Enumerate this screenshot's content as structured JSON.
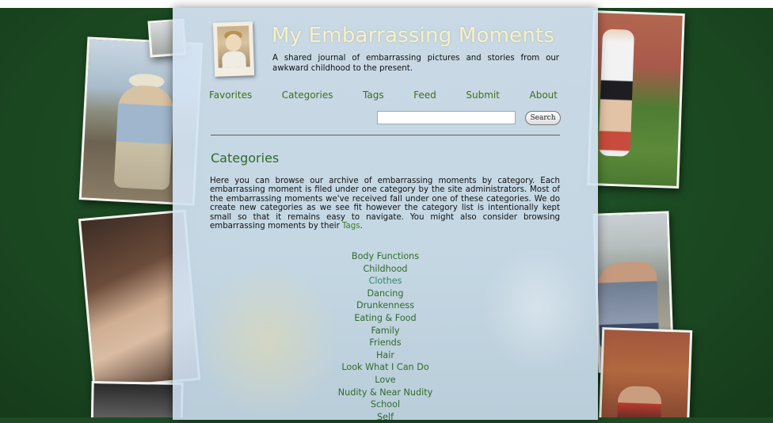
{
  "site": {
    "title": "My Embarrassing Moments",
    "tagline": "A shared journal of embarrassing pictures and stories from our awkward childhood to the present."
  },
  "nav": {
    "items": [
      "Favorites",
      "Categories",
      "Tags",
      "Feed",
      "Submit",
      "About"
    ]
  },
  "search": {
    "value": "",
    "button_label": "Search"
  },
  "page": {
    "heading": "Categories",
    "intro": "Here you can browse our archive of embarrassing moments by category. Each embarrassing moment is filed under one category by the site administrators. Most of the embarrassing moments we've received fall under one of these categories. We do create new categories as we see fit however the category list is intentionally kept small so that it remains easy to navigate. You might also consider browsing embarrassing moments by their ",
    "intro_link": "Tags",
    "intro_end": "."
  },
  "categories": {
    "items": [
      "Body Functions",
      "Childhood",
      "Clothes",
      "Dancing",
      "Drunkenness",
      "Eating & Food",
      "Family",
      "Friends",
      "Hair",
      "Look What I Can Do",
      "Love",
      "Nudity & Near Nudity",
      "School",
      "Self"
    ],
    "hovered": "Clothes"
  },
  "colors": {
    "background": "#1d4a23",
    "link": "#3e6e1a",
    "heading": "#2f6a2e",
    "title": "#f7f1c8"
  }
}
